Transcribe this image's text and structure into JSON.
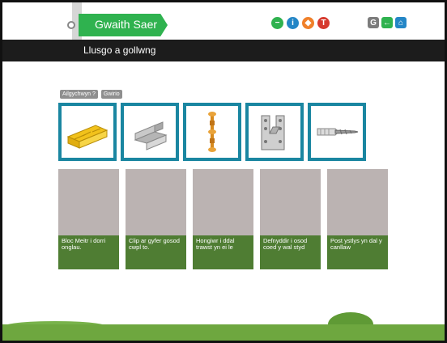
{
  "header": {
    "sign_title": "Gwaith Saer",
    "nav_icons": [
      {
        "name": "minus-icon",
        "glyph": "−",
        "color": "#2fb24f"
      },
      {
        "name": "info-icon",
        "glyph": "i",
        "color": "#2486c6"
      },
      {
        "name": "diamond-icon",
        "glyph": "◆",
        "color": "#f0802a"
      },
      {
        "name": "tool-icon",
        "glyph": "T",
        "color": "#d63a2e"
      }
    ],
    "sys_icons": [
      {
        "name": "g-icon",
        "glyph": "G",
        "color": "#7c7c7c"
      },
      {
        "name": "back-icon",
        "glyph": "←",
        "color": "#2fb24f"
      },
      {
        "name": "home-icon",
        "glyph": "⌂",
        "color": "#2486c6"
      }
    ]
  },
  "titlebar": {
    "title": "Llusgo a gollwng"
  },
  "buttons": {
    "reset": "Ailgychwyn ?",
    "check": "Gwirio"
  },
  "tiles": [
    {
      "name": "mitre-box-icon"
    },
    {
      "name": "joist-clip-icon"
    },
    {
      "name": "spacer-bar-icon"
    },
    {
      "name": "joist-hanger-icon"
    },
    {
      "name": "wall-plug-screw-icon"
    }
  ],
  "zones": [
    {
      "label": "Bloc Meitr i dorri onglau."
    },
    {
      "label": "Clip ar gyfer gosod cwpl to."
    },
    {
      "label": "Hongiwr i ddal trawst yn ei le"
    },
    {
      "label": "Defnyddir i osod coed y wal styd"
    },
    {
      "label": "Post ystlys yn dal y canllaw"
    }
  ],
  "colors": {
    "accent": "#1a86a1",
    "sign": "#2fb24f",
    "zone_label_bg": "#4f7d33",
    "zone_bg": "#bbb3b2"
  }
}
